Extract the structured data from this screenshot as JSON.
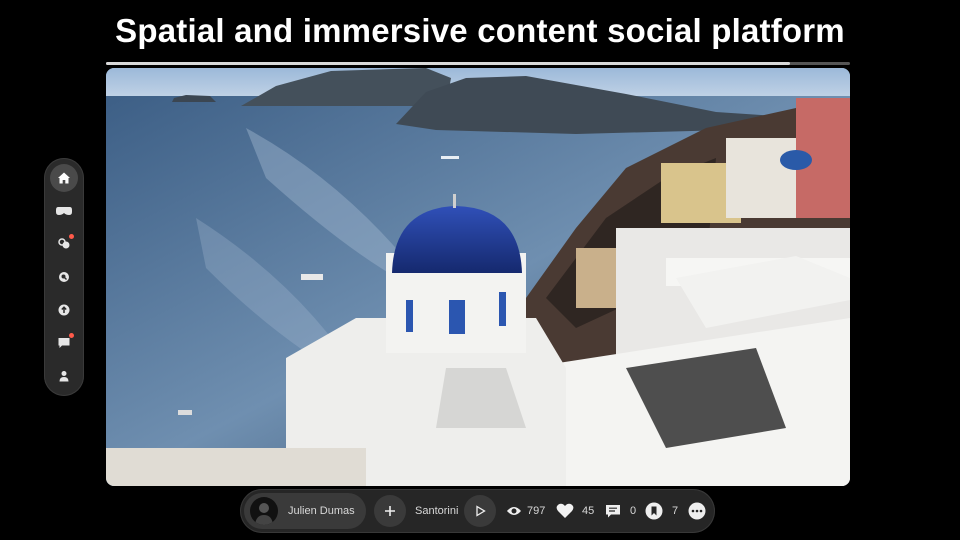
{
  "headline": "Spatial and immersive content social platform",
  "player": {
    "progress": 0.92
  },
  "sidebar": {
    "items": [
      {
        "name": "home",
        "icon": "home-icon",
        "active": true,
        "badge": false
      },
      {
        "name": "immersive",
        "icon": "vision-headset-icon",
        "active": false,
        "badge": false
      },
      {
        "name": "social",
        "icon": "people-icon",
        "active": false,
        "badge": true
      },
      {
        "name": "search",
        "icon": "search-icon",
        "active": false,
        "badge": false
      },
      {
        "name": "upload",
        "icon": "upload-icon",
        "active": false,
        "badge": false
      },
      {
        "name": "messages",
        "icon": "chat-icon",
        "active": false,
        "badge": true
      },
      {
        "name": "profile",
        "icon": "person-icon",
        "active": false,
        "badge": false
      }
    ],
    "badge_color": "#ff5a4a"
  },
  "bottom_bar": {
    "author": "Julien Dumas",
    "location": "Santorini",
    "views": "797",
    "likes": "45",
    "comments": "0",
    "saves": "7"
  }
}
